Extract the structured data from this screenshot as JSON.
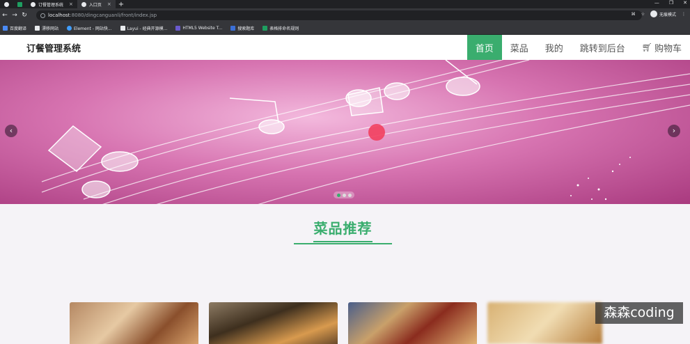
{
  "browser": {
    "tabs": [
      {
        "title": "",
        "active": false
      },
      {
        "title": "",
        "active": false
      },
      {
        "title": "订餐管理系统",
        "active": false
      },
      {
        "title": "入口页",
        "active": true
      }
    ],
    "url_host": "localhost",
    "url_path": ":8080/dingcanguanli/front/index.jsp",
    "incognito_label": "无痕模式",
    "bookmarks": [
      {
        "label": "百度翻译"
      },
      {
        "label": "漂移网站"
      },
      {
        "label": "Element - 网站快..."
      },
      {
        "label": "Layui - 经典开源模..."
      },
      {
        "label": "HTML5 Website T..."
      },
      {
        "label": "搜索题库"
      },
      {
        "label": "表格排命名规则"
      }
    ]
  },
  "header": {
    "brand": "订餐管理系统",
    "nav": [
      {
        "label": "首页",
        "active": true
      },
      {
        "label": "菜品",
        "active": false
      },
      {
        "label": "我的",
        "active": false
      },
      {
        "label": "跳转到后台",
        "active": false
      },
      {
        "label": "购物车",
        "active": false
      }
    ]
  },
  "banner": {
    "slide_count": 3,
    "active_slide": 1
  },
  "section": {
    "title": "菜品推荐"
  },
  "watermark": "森森coding",
  "colors": {
    "accent": "#3aad6e",
    "banner_base": "#d774b1"
  }
}
